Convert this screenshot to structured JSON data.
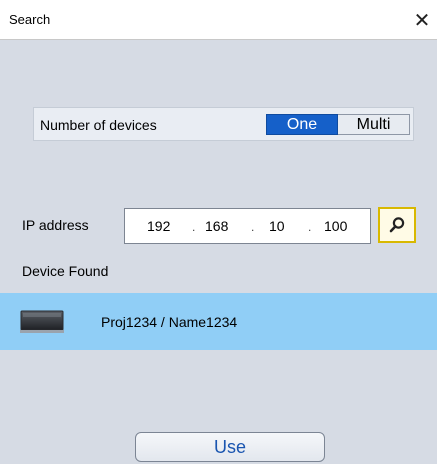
{
  "window": {
    "title": "Search",
    "close_glyph": "✕"
  },
  "devices": {
    "label": "Number of devices",
    "options": [
      "One",
      "Multi"
    ],
    "selected": "One"
  },
  "ip": {
    "label": "IP address",
    "octets": [
      "192",
      "168",
      "10",
      "100"
    ],
    "separator": "."
  },
  "found": {
    "label": "Device Found",
    "items": [
      {
        "name": "Proj1234 / Name1234",
        "icon": "monitor-icon",
        "selected": true
      }
    ]
  },
  "actions": {
    "use_label": "Use"
  },
  "colors": {
    "selected_segment": "#1560c9",
    "selected_row": "#90cef6",
    "search_border": "#d8b800",
    "dialog_bg": "#d6dbe4"
  }
}
